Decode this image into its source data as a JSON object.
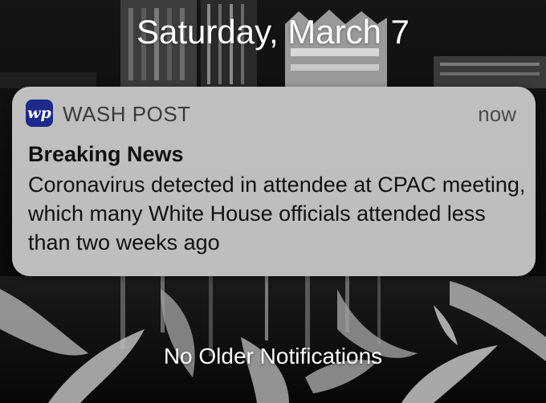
{
  "lock_screen": {
    "date": "Saturday, March 7",
    "footer_text": "No Older Notifications"
  },
  "notification": {
    "app_icon_text": "wp",
    "app_icon_color": "#1d2a8c",
    "app_name": "WASH POST",
    "time": "now",
    "title": "Breaking News",
    "body": "Coronavirus detected in attendee at CPAC meeting, which many White House officials attended less than two weeks ago"
  },
  "wallpaper": {
    "description_icon": "city-skyline-night-wallpaper"
  }
}
